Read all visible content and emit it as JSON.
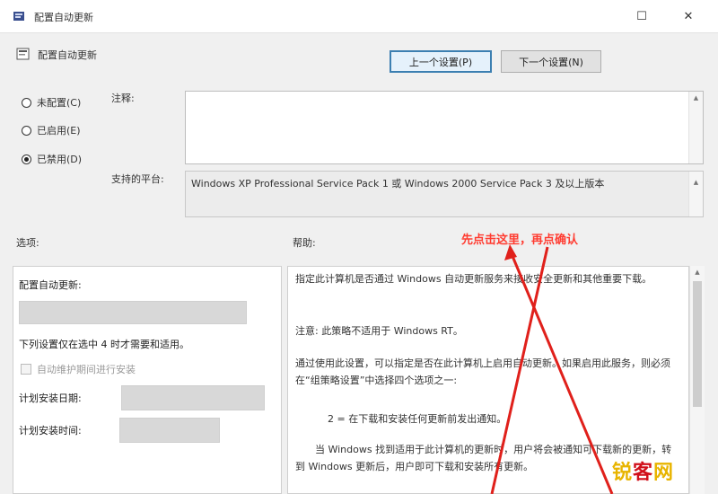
{
  "window": {
    "title": "配置自动更新",
    "maximize_glyph": "☐",
    "close_glyph": "✕"
  },
  "header": {
    "title": "配置自动更新",
    "prev_button": "上一个设置(P)",
    "next_button": "下一个设置(N)"
  },
  "state_options": [
    {
      "label": "未配置(C)",
      "selected": false
    },
    {
      "label": "已启用(E)",
      "selected": false
    },
    {
      "label": "已禁用(D)",
      "selected": true
    }
  ],
  "comment": {
    "label": "注释:",
    "value": ""
  },
  "supported": {
    "label": "支持的平台:",
    "value": "Windows XP Professional Service Pack 1 或 Windows 2000 Service Pack 3 及以上版本"
  },
  "options_pane": {
    "label": "选项:",
    "heading": "配置自动更新:",
    "required_note": "下列设置仅在选中 4 时才需要和适用。",
    "checkbox_label": "自动维护期间进行安装",
    "install_day_label": "计划安装日期:",
    "install_time_label": "计划安装时间:"
  },
  "help_pane": {
    "label": "帮助:",
    "paragraphs": [
      "指定此计算机是否通过 Windows 自动更新服务来接收安全更新和其他重要下载。",
      "注意: 此策略不适用于 Windows RT。",
      "通过使用此设置，可以指定是否在此计算机上启用自动更新。如果启用此服务，则必须在“组策略设置”中选择四个选项之一:",
      "2 = 在下载和安装任何更新前发出通知。",
      "当 Windows 找到适用于此计算机的更新时，用户将会被通知可下载新的更新，转到 Windows 更新后，用户即可下载和安装所有更新。"
    ]
  },
  "annotation": {
    "text": "先点击这里，再点确认",
    "color": "#ff3b30"
  },
  "watermark": {
    "part1": "锐",
    "part2": "客",
    "part3": "网"
  }
}
